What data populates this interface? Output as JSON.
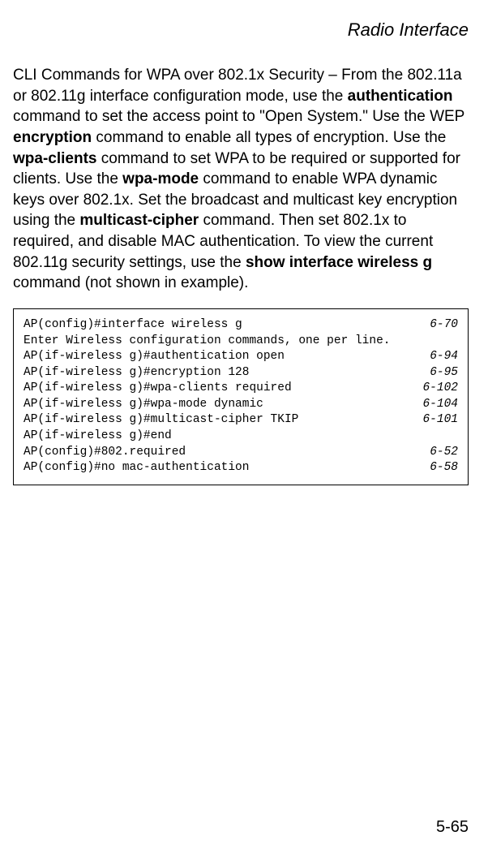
{
  "header": {
    "title": "Radio Interface"
  },
  "body": {
    "p1_part1": "CLI Commands for WPA over 802.1x Security – From the 802.11a or 802.11g interface configuration mode, use the ",
    "p1_bold1": "authentication",
    "p1_part2": " command to set the access point to \"Open System.\" Use the WEP ",
    "p1_bold2": "encryption",
    "p1_part3": " command to enable all types of encryption. Use the ",
    "p1_bold3": "wpa-clients",
    "p1_part4": " command to set WPA to be required or supported for clients. Use the ",
    "p1_bold4": "wpa-mode",
    "p1_part5": " command to enable WPA dynamic keys over 802.1x. Set the broadcast and multicast key encryption using the ",
    "p1_bold5": "multicast-cipher",
    "p1_part6": " command. Then set 802.1x to required, and disable MAC authentication. To view the current 802.11g security settings, use the ",
    "p1_bold6": "show interface wireless g",
    "p1_part7": " command (not shown in example)."
  },
  "code": {
    "lines": [
      {
        "left": "AP(config)#interface wireless g",
        "right": "6-70"
      },
      {
        "left": "Enter Wireless configuration commands, one per line.",
        "right": ""
      },
      {
        "left": "AP(if-wireless g)#authentication open",
        "right": "6-94"
      },
      {
        "left": "AP(if-wireless g)#encryption 128",
        "right": "6-95"
      },
      {
        "left": "AP(if-wireless g)#wpa-clients required",
        "right": "6-102"
      },
      {
        "left": "AP(if-wireless g)#wpa-mode dynamic",
        "right": "6-104"
      },
      {
        "left": "AP(if-wireless g)#multicast-cipher TKIP",
        "right": "6-101"
      },
      {
        "left": "AP(if-wireless g)#end",
        "right": ""
      },
      {
        "left": "AP(config)#802.required",
        "right": "6-52"
      },
      {
        "left": "AP(config)#no mac-authentication",
        "right": "6-58"
      }
    ]
  },
  "footer": {
    "page": "5-65"
  }
}
